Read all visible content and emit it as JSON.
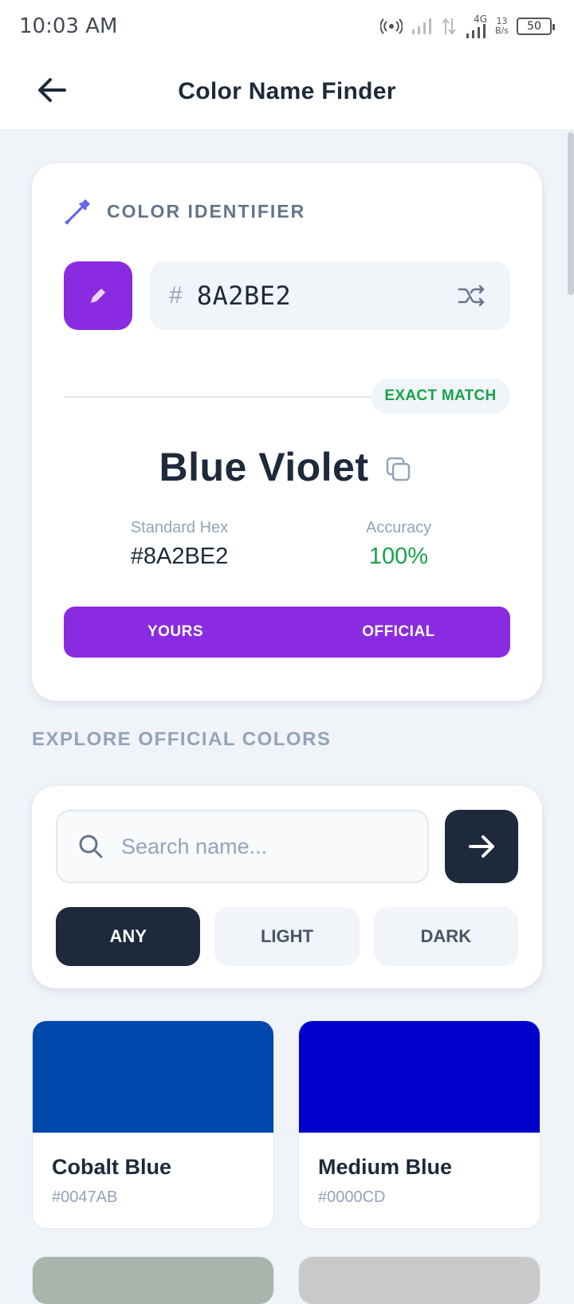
{
  "status_bar": {
    "time": "10:03 AM",
    "network_type": "4G",
    "speed_value": "13",
    "speed_unit": "B/s",
    "battery": "50"
  },
  "app_bar": {
    "title": "Color Name Finder",
    "back_icon": "arrow-left-icon"
  },
  "identifier": {
    "section_label": "COLOR IDENTIFIER",
    "section_icon": "eyedropper-icon",
    "swatch_color": "#8A2BE2",
    "hex_prefix": "#",
    "hex_input": "8A2BE2",
    "shuffle_icon": "shuffle-icon",
    "match_badge": "EXACT MATCH",
    "color_name": "Blue Violet",
    "copy_icon": "copy-icon",
    "standard_hex_label": "Standard Hex",
    "standard_hex_value": "#8A2BE2",
    "accuracy_label": "Accuracy",
    "accuracy_value": "100%",
    "compare_yours_label": "YOURS",
    "compare_official_label": "OFFICIAL",
    "yours_color": "#8A2BE2",
    "official_color": "#8A2BE2"
  },
  "explore": {
    "heading": "EXPLORE OFFICIAL COLORS",
    "search_placeholder": "Search name...",
    "search_value": "",
    "filters": [
      {
        "label": "ANY",
        "active": true
      },
      {
        "label": "LIGHT",
        "active": false
      },
      {
        "label": "DARK",
        "active": false
      }
    ],
    "colors": [
      {
        "name": "Cobalt Blue",
        "hex": "#0047AB"
      },
      {
        "name": "Medium Blue",
        "hex": "#0000CD"
      }
    ]
  },
  "theme": {
    "accent": "#8A2BE2",
    "dark": "#1E293B",
    "success": "#16A34A",
    "partial_swatch_colors": [
      "#A8B5AD",
      "#C9C9C9"
    ]
  }
}
